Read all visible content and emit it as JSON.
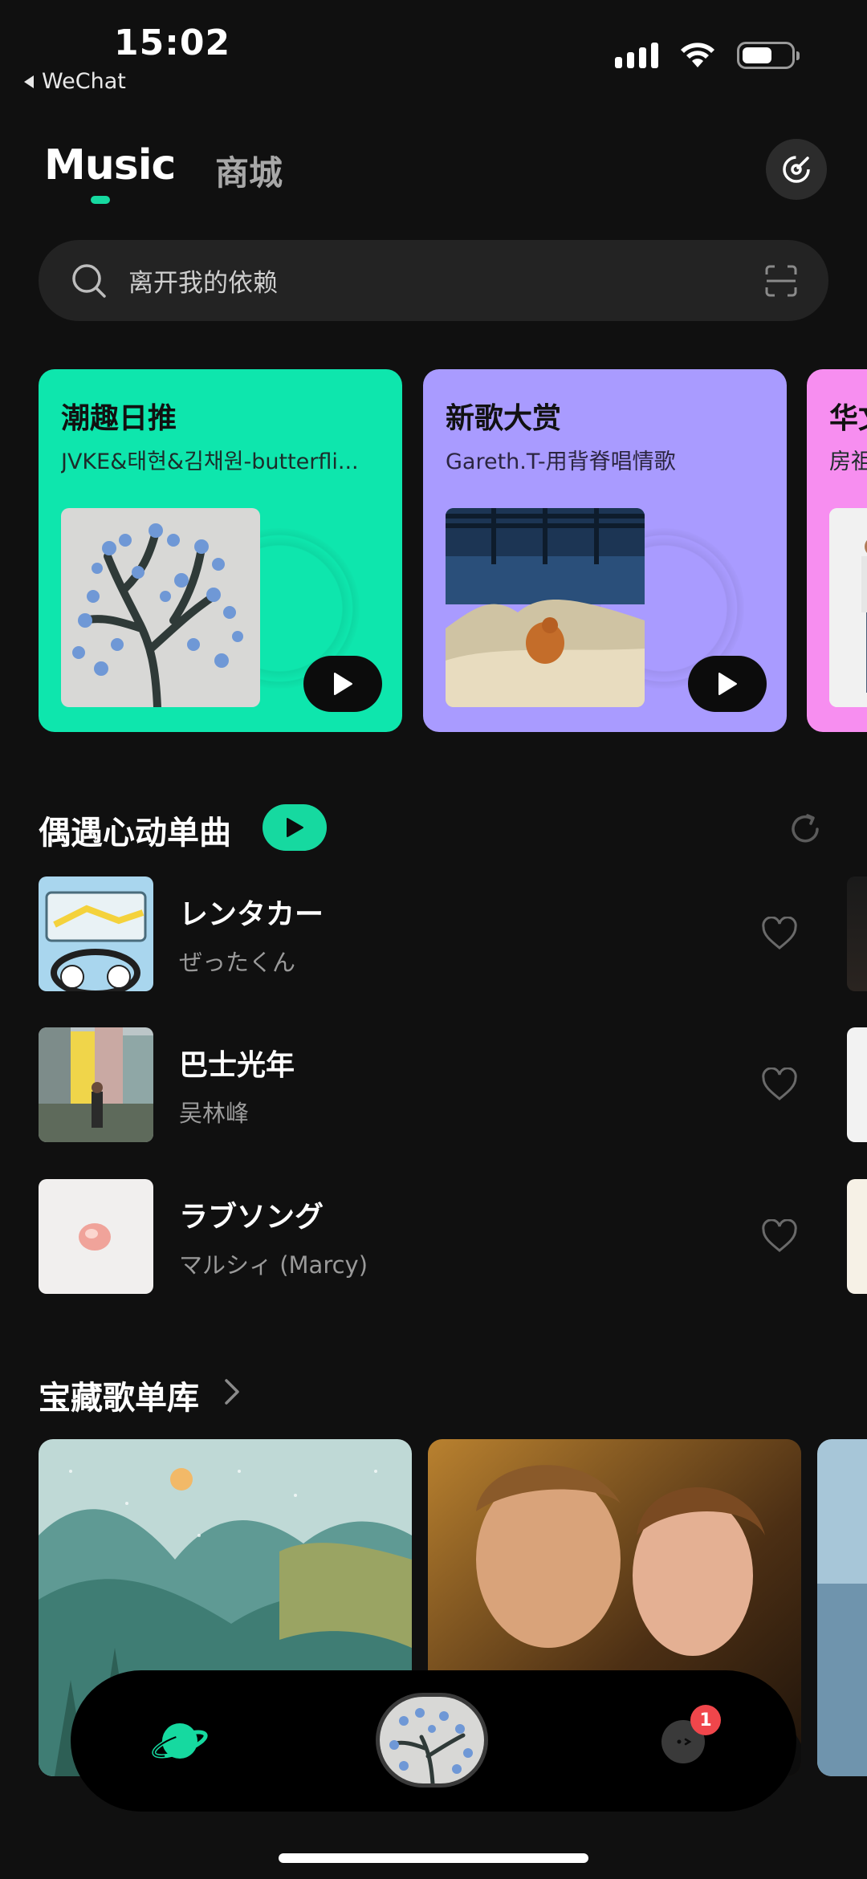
{
  "status_bar": {
    "time": "15:02",
    "back_label": "WeChat"
  },
  "header": {
    "tab_music": "Music",
    "tab_shop": "商城"
  },
  "search": {
    "placeholder": "离开我的依赖"
  },
  "cards": [
    {
      "title": "潮趣日推",
      "subtitle": "JVKE&태현&김채원-butterfli..."
    },
    {
      "title": "新歌大赏",
      "subtitle": "Gareth.T-用背脊唱情歌"
    },
    {
      "title": "华文",
      "subtitle": "房祖"
    }
  ],
  "section_singles": {
    "title": "偶遇心动单曲"
  },
  "songs": [
    {
      "title": "レンタカー",
      "artist": "ぜったくん"
    },
    {
      "title": "巴士光年",
      "artist": "吴林峰"
    },
    {
      "title": "ラブソング",
      "artist": "マルシィ (Marcy)"
    }
  ],
  "section_playlists": {
    "title": "宝藏歌单库"
  },
  "bottom_nav": {
    "badge_count": "1"
  },
  "colors": {
    "accent": "#16d9a0",
    "card_green": "#0ee6ad",
    "card_purple": "#a99bff",
    "card_pink": "#f78ef0",
    "badge": "#f0464b"
  }
}
